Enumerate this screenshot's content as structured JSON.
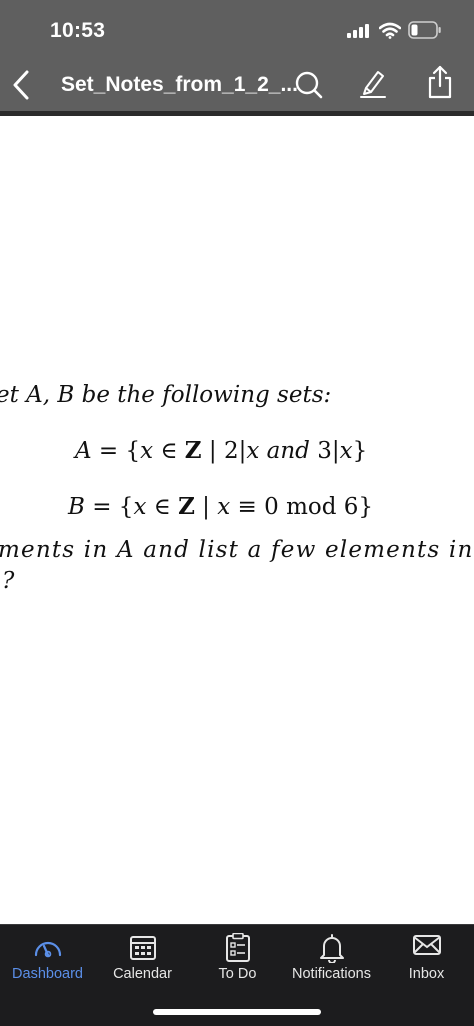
{
  "status_bar": {
    "time": "10:53"
  },
  "nav": {
    "title": "Set_Notes_from_1_2_...",
    "icons": [
      "back-chevron-icon",
      "search-icon",
      "pen-annotate-icon",
      "share-icon"
    ]
  },
  "document": {
    "intro": "et A, B be the following sets:",
    "set_a": {
      "lhs": "A",
      "eq": " = {",
      "var1": "x",
      "in": " ∈ ",
      "Z": "Z",
      "bar": " | 2|",
      "var2": "x",
      "and": " and ",
      "three": "3|",
      "var3": "x",
      "close": "}"
    },
    "set_b": {
      "lhs": "B",
      "eq": " = {",
      "var1": "x",
      "in": " ∈ ",
      "Z": "Z",
      "bar": " | ",
      "var2": "x",
      "rest": " ≡ 0 mod 6}"
    },
    "question_line1": "ments in A and list a few elements in B.",
    "question_line2": "?"
  },
  "tabbar": {
    "tabs": [
      {
        "label": "Dashboard",
        "icon": "dashboard-gauge-icon",
        "active": true
      },
      {
        "label": "Calendar",
        "icon": "calendar-icon",
        "active": false
      },
      {
        "label": "To Do",
        "icon": "todo-list-icon",
        "active": false
      },
      {
        "label": "Notifications",
        "icon": "bell-icon",
        "active": false
      },
      {
        "label": "Inbox",
        "icon": "envelope-icon",
        "active": false
      }
    ]
  },
  "colors": {
    "header_bg": "#5f5f5f",
    "tabbar_bg": "#1c1c1e",
    "active_tab": "#5b8fe8"
  }
}
